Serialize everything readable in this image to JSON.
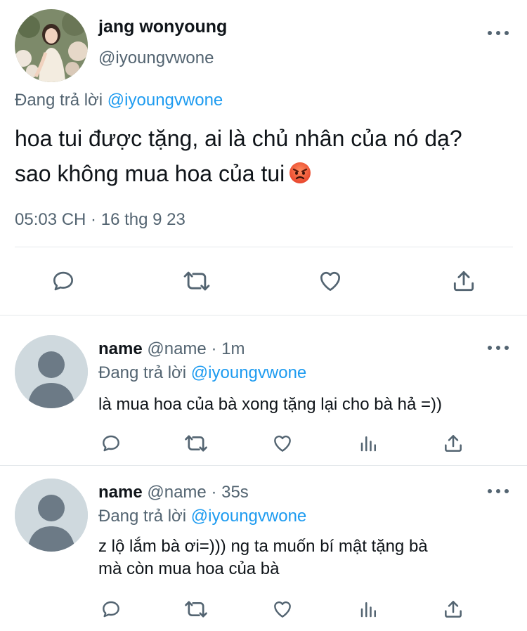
{
  "main_tweet": {
    "author_name": "jang wonyoung",
    "author_handle": "@iyoungvwone",
    "replying_prefix": "Đang trả lời",
    "replying_mention": "@iyoungvwone",
    "text_line1": "hoa tui được tặng, ai là chủ nhân của nó dạ?",
    "text_line2": "sao không mua hoa của tui",
    "emoji": "angry-face-emoji",
    "timestamp": "05:03 CH · 16 thg 9 23",
    "actions": [
      "reply-icon",
      "retweet-icon",
      "like-icon",
      "share-icon"
    ]
  },
  "replies": [
    {
      "name": "name",
      "meta": "@name · 1m",
      "replying_prefix": "Đang trả lời",
      "replying_mention": "@iyoungvwone",
      "lines": [
        "là mua hoa của bà xong tặng lại cho bà hả =))"
      ]
    },
    {
      "name": "name",
      "meta": "@name · 35s",
      "replying_prefix": "Đang trả lời",
      "replying_mention": "@iyoungvwone",
      "lines": [
        "z lộ lắm bà ơi=))) ng ta muốn bí mật tặng bà",
        "mà còn mua hoa của bà"
      ]
    }
  ],
  "colors": {
    "text": "#0f1419",
    "secondary": "#536471",
    "link": "#1d9bf0",
    "divider": "#e4e8eb",
    "default_avatar_bg": "#cfd9de",
    "default_avatar_fg": "#6c7a86"
  }
}
